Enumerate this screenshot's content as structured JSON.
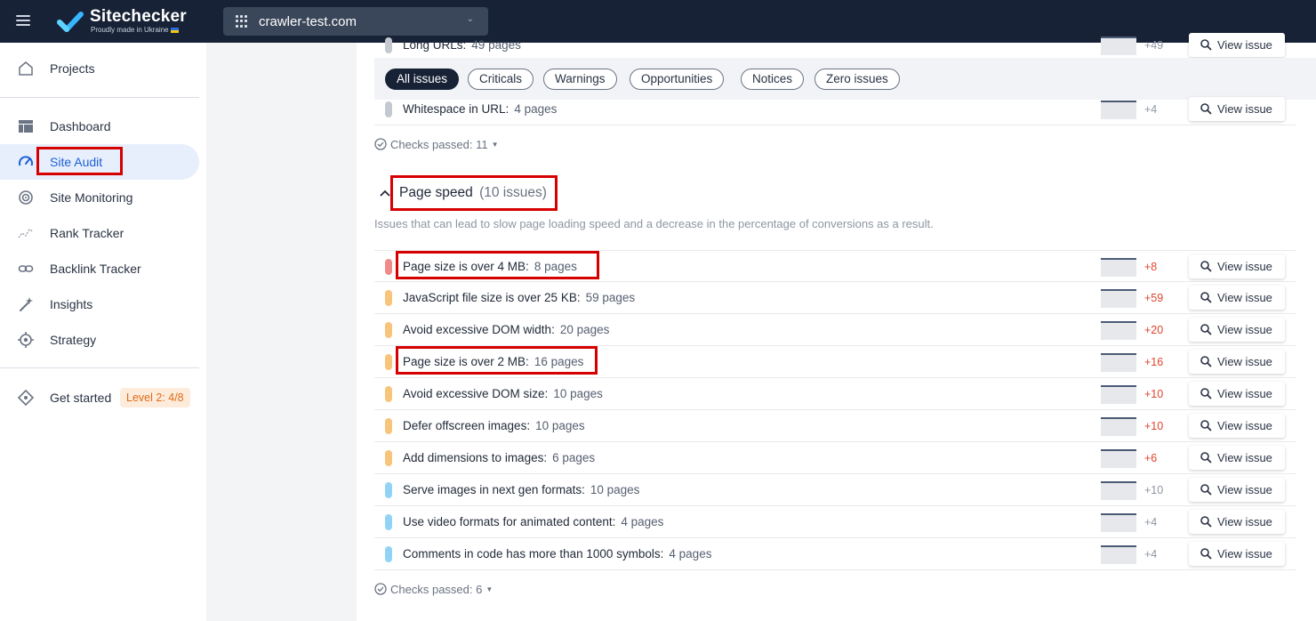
{
  "app": {
    "logo_name": "Sitechecker",
    "logo_tagline": "Proudly made in Ukraine",
    "project": "crawler-test.com"
  },
  "sidebar": {
    "items": [
      {
        "label": "Projects",
        "icon": "home-icon"
      },
      {
        "label": "Dashboard",
        "icon": "dashboard-icon"
      },
      {
        "label": "Site Audit",
        "icon": "speedometer-icon"
      },
      {
        "label": "Site Monitoring",
        "icon": "monitoring-icon"
      },
      {
        "label": "Rank Tracker",
        "icon": "rank-tracker-icon"
      },
      {
        "label": "Backlink Tracker",
        "icon": "link-icon"
      },
      {
        "label": "Insights",
        "icon": "magic-wand-icon"
      },
      {
        "label": "Strategy",
        "icon": "target-icon"
      },
      {
        "label": "Get started",
        "icon": "rocket-icon"
      }
    ],
    "active": "Site Audit",
    "level_badge": "Level 2: 4/8"
  },
  "filters": {
    "chips": [
      "All issues",
      "Criticals",
      "Warnings",
      "Opportunities",
      "Notices",
      "Zero issues"
    ],
    "active": "All issues"
  },
  "prev_section": {
    "rows": [
      {
        "text": "Long URLs:",
        "count": "49 pages",
        "delta": "+49",
        "severity": "notice"
      },
      {
        "text": "Whitespace in URL:",
        "count": "4 pages",
        "delta": "+4",
        "severity": "notice"
      }
    ],
    "checks_passed": "Checks passed: 11"
  },
  "page_speed": {
    "title": "Page speed",
    "issues_count": "(10 issues)",
    "description": "Issues that can lead to slow page loading speed and a decrease in the percentage of conversions as a result.",
    "rows": [
      {
        "text": "Page size is over 4 MB:",
        "count": "8 pages",
        "delta": "+8",
        "severity": "critical"
      },
      {
        "text": "JavaScript file size is over 25 KB:",
        "count": "59 pages",
        "delta": "+59",
        "severity": "warning"
      },
      {
        "text": "Avoid excessive DOM width:",
        "count": "20 pages",
        "delta": "+20",
        "severity": "warning"
      },
      {
        "text": "Page size is over 2 MB:",
        "count": "16 pages",
        "delta": "+16",
        "severity": "warning"
      },
      {
        "text": "Avoid excessive DOM size:",
        "count": "10 pages",
        "delta": "+10",
        "severity": "warning"
      },
      {
        "text": "Defer offscreen images:",
        "count": "10 pages",
        "delta": "+10",
        "severity": "warning"
      },
      {
        "text": "Add dimensions to images:",
        "count": "6 pages",
        "delta": "+6",
        "severity": "warning"
      },
      {
        "text": "Serve images in next gen formats:",
        "count": "10 pages",
        "delta": "+10",
        "severity": "opportunity"
      },
      {
        "text": "Use video formats for animated content:",
        "count": "4 pages",
        "delta": "+4",
        "severity": "opportunity"
      },
      {
        "text": "Comments in code has more than 1000 symbols:",
        "count": "4 pages",
        "delta": "+4",
        "severity": "opportunity"
      }
    ],
    "checks_passed": "Checks passed: 6"
  },
  "view_issue_label": "View issue",
  "colors": {
    "critical": "#f08a8a",
    "warning": "#f8c37a",
    "opportunity": "#92d3f5",
    "notice": "#c4c9d1",
    "accent": "#1d5fd6",
    "highlight": "#d60000"
  }
}
